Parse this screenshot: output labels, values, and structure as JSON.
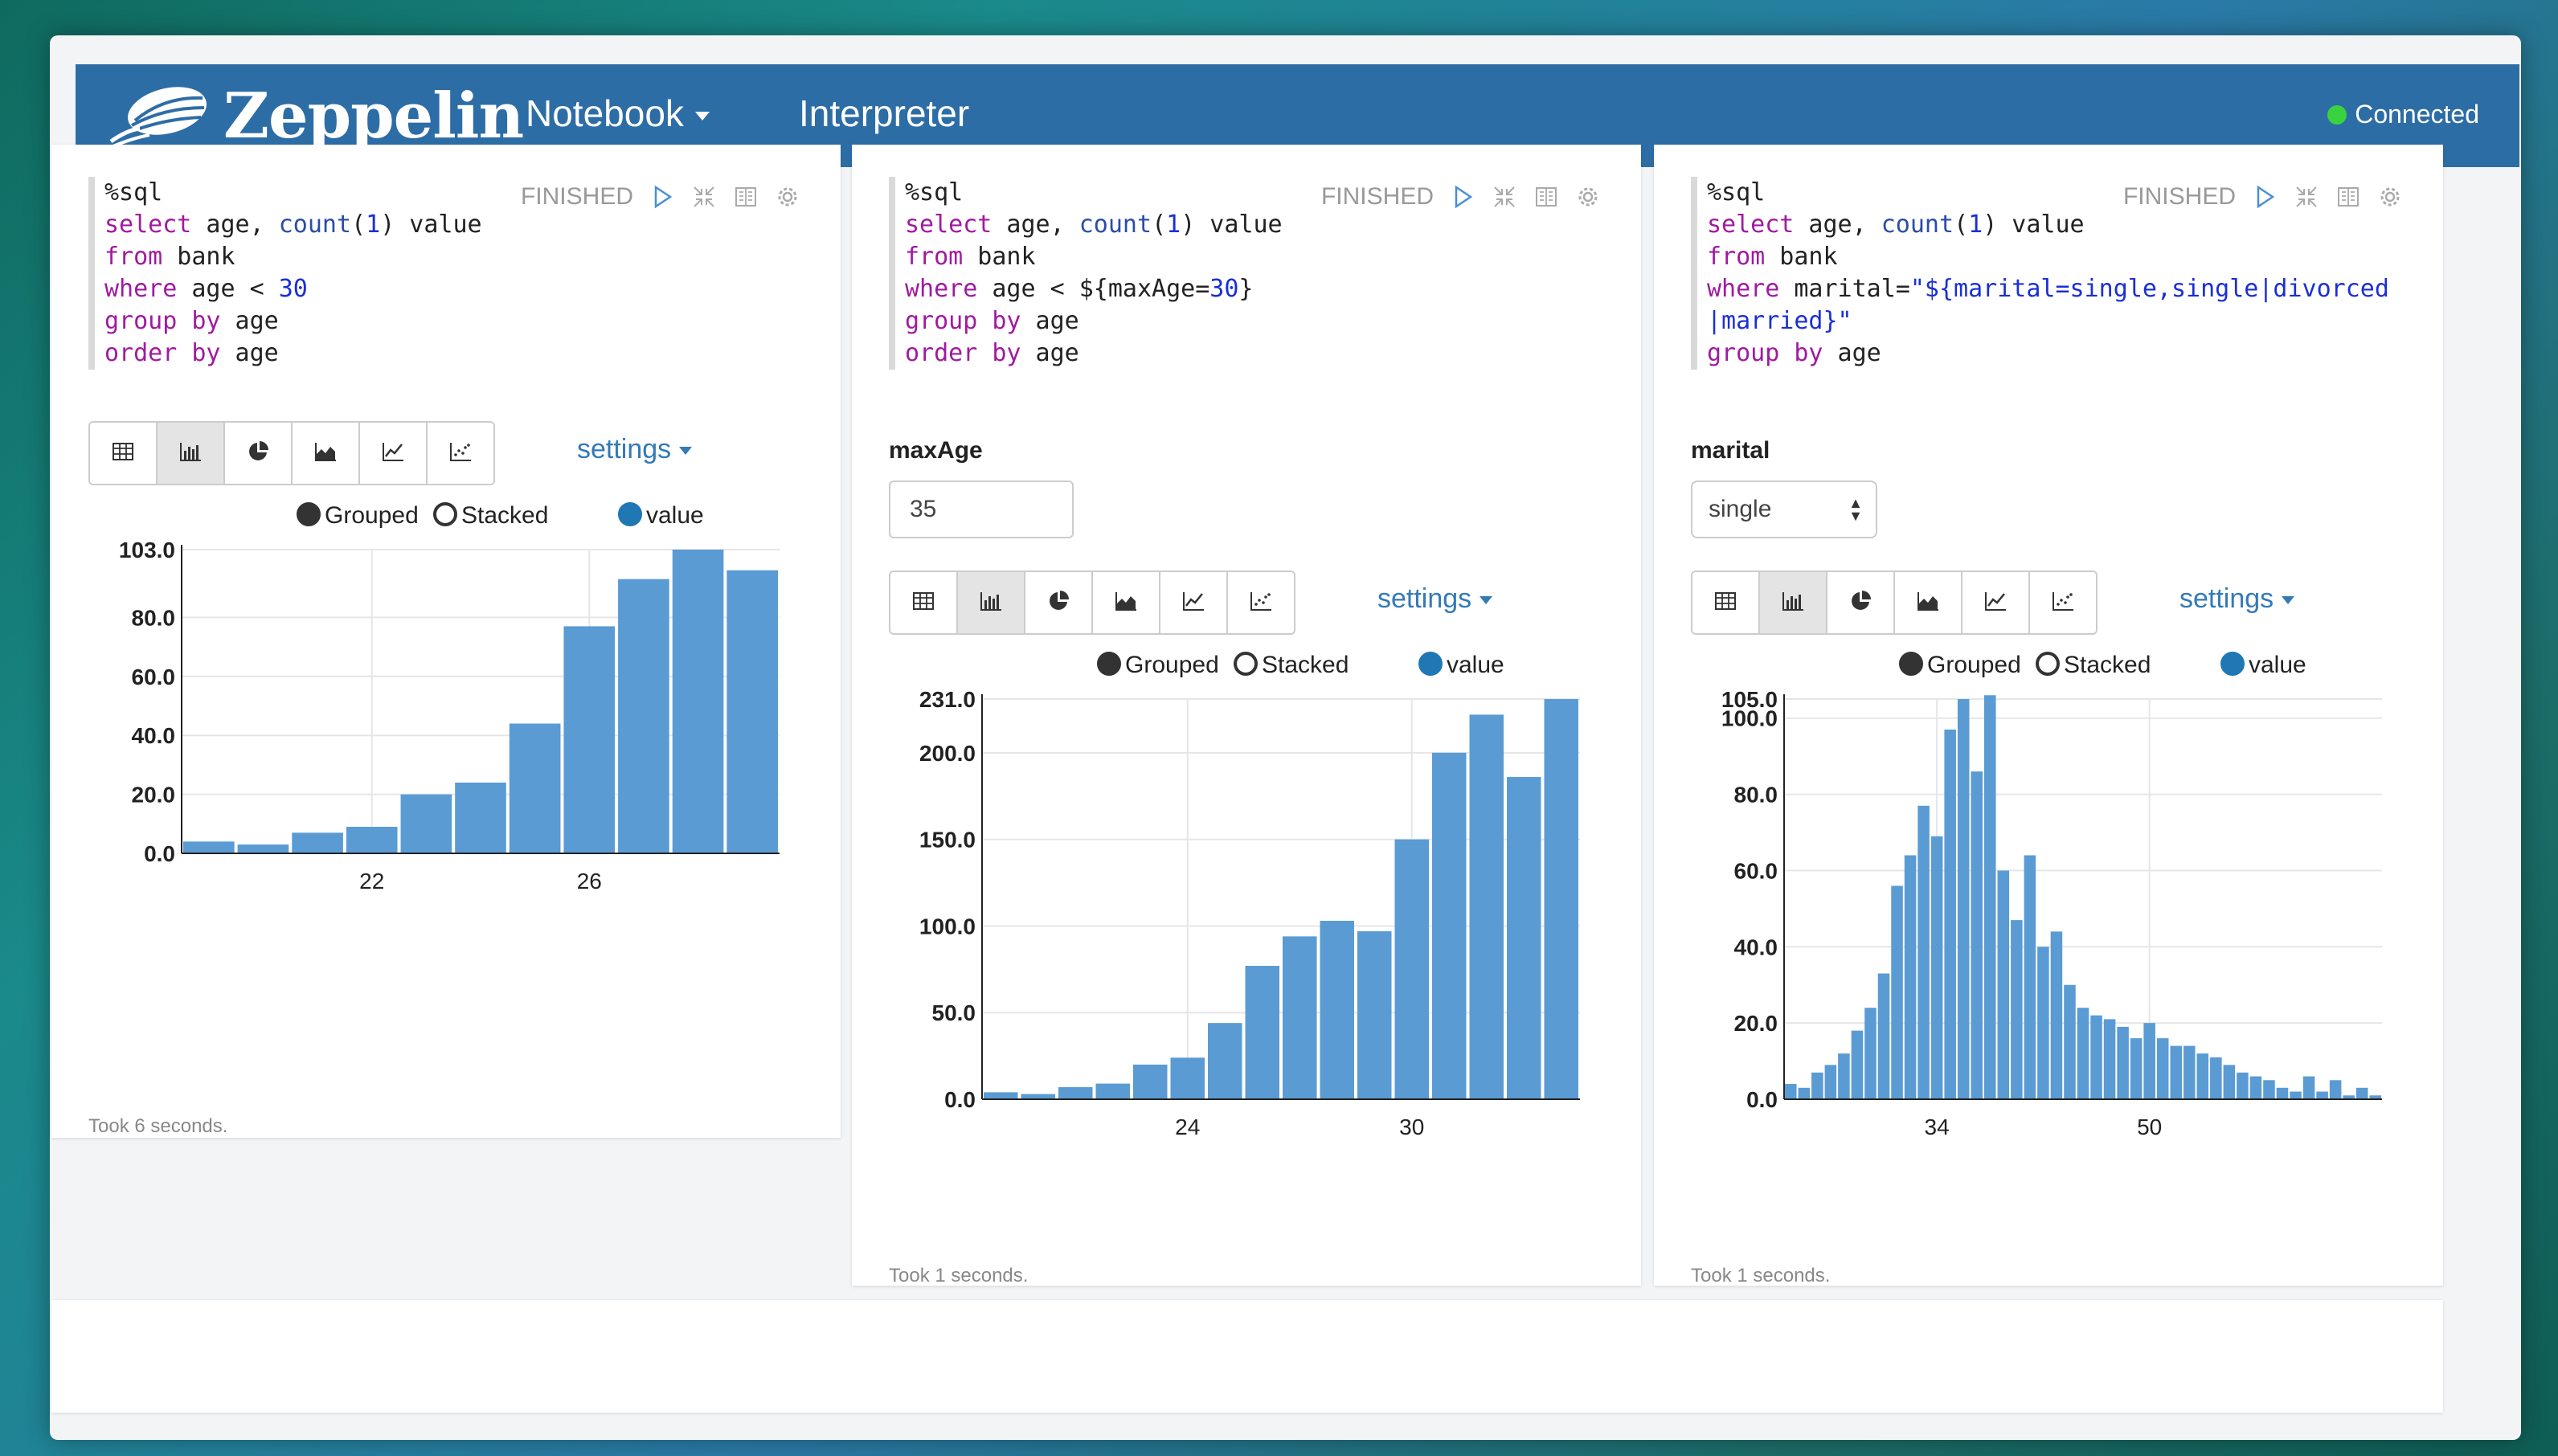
{
  "app": {
    "brand": "Zeppelin",
    "nav": {
      "notebook": "Notebook",
      "interpreter": "Interpreter"
    },
    "status": "Connected",
    "colors": {
      "navbar": "#2d6da6",
      "bar": "#5a9bd4",
      "connected": "#3ad340",
      "link": "#337ab7"
    }
  },
  "legend": {
    "grouped": "Grouped",
    "stacked": "Stacked",
    "value": "value"
  },
  "toolbar_icons": [
    "table-icon",
    "bar-chart-icon",
    "pie-chart-icon",
    "area-chart-icon",
    "line-chart-icon",
    "scatter-chart-icon"
  ],
  "paragraphs": [
    {
      "status": "FINISHED",
      "code": [
        [
          [
            "%sql",
            "plain"
          ]
        ],
        [
          [
            "select",
            "kw"
          ],
          [
            " age, ",
            "plain"
          ],
          [
            "count",
            "fn"
          ],
          [
            "(",
            "plain"
          ],
          [
            "1",
            "num"
          ],
          [
            ") value",
            "plain"
          ]
        ],
        [
          [
            "from",
            "kw"
          ],
          [
            " bank",
            "plain"
          ]
        ],
        [
          [
            "where",
            "kw"
          ],
          [
            " age < ",
            "plain"
          ],
          [
            "30",
            "num"
          ]
        ],
        [
          [
            "group by",
            "kw"
          ],
          [
            " age",
            "plain"
          ]
        ],
        [
          [
            "order by",
            "kw"
          ],
          [
            " age",
            "plain"
          ]
        ]
      ],
      "settings": "settings",
      "took": "Took 6 seconds."
    },
    {
      "status": "FINISHED",
      "code": [
        [
          [
            "%sql",
            "plain"
          ]
        ],
        [
          [
            "select",
            "kw"
          ],
          [
            " age, ",
            "plain"
          ],
          [
            "count",
            "fn"
          ],
          [
            "(",
            "plain"
          ],
          [
            "1",
            "num"
          ],
          [
            ") value",
            "plain"
          ]
        ],
        [
          [
            "from",
            "kw"
          ],
          [
            " bank",
            "plain"
          ]
        ],
        [
          [
            "where",
            "kw"
          ],
          [
            " age < ${maxAge=",
            "plain"
          ],
          [
            "30",
            "num"
          ],
          [
            "}",
            "plain"
          ]
        ],
        [
          [
            "group by",
            "kw"
          ],
          [
            " age",
            "plain"
          ]
        ],
        [
          [
            "order by",
            "kw"
          ],
          [
            " age",
            "plain"
          ]
        ]
      ],
      "param_label": "maxAge",
      "param_value": "35",
      "settings": "settings",
      "took": "Took 1 seconds."
    },
    {
      "status": "FINISHED",
      "code": [
        [
          [
            "%sql",
            "plain"
          ]
        ],
        [
          [
            "select",
            "kw"
          ],
          [
            " age, ",
            "plain"
          ],
          [
            "count",
            "fn"
          ],
          [
            "(",
            "plain"
          ],
          [
            "1",
            "num"
          ],
          [
            ") value",
            "plain"
          ]
        ],
        [
          [
            "from",
            "kw"
          ],
          [
            " bank",
            "plain"
          ]
        ],
        [
          [
            "where",
            "kw"
          ],
          [
            " marital=",
            "plain"
          ],
          [
            "\"${marital=single,single|divorced",
            "str"
          ]
        ],
        [
          [
            "|married}\"",
            "str"
          ]
        ],
        [
          [
            "group by",
            "kw"
          ],
          [
            " age",
            "plain"
          ]
        ]
      ],
      "param_label": "marital",
      "param_value": "single",
      "settings": "settings",
      "took": "Took 1 seconds."
    }
  ],
  "chart_data": [
    {
      "type": "bar",
      "x": [
        19,
        20,
        21,
        22,
        23,
        24,
        25,
        26,
        27,
        28,
        29
      ],
      "values": [
        4,
        3,
        7,
        9,
        20,
        24,
        44,
        77,
        93,
        103,
        96
      ],
      "ylim": [
        0,
        103
      ],
      "yticks": [
        0,
        20,
        40,
        60,
        80,
        103
      ],
      "ytick_labels": [
        "0.0",
        "20.0",
        "40.0",
        "60.0",
        "80.0",
        "103.0"
      ],
      "xticks": [
        22,
        26
      ],
      "xtick_labels": [
        "22",
        "26"
      ]
    },
    {
      "type": "bar",
      "x": [
        19,
        20,
        21,
        22,
        23,
        24,
        25,
        26,
        27,
        28,
        29,
        30,
        31,
        32,
        33,
        34
      ],
      "values": [
        4,
        3,
        7,
        9,
        20,
        24,
        44,
        77,
        94,
        103,
        97,
        150,
        200,
        222,
        186,
        231
      ],
      "ylim": [
        0,
        231
      ],
      "yticks": [
        0,
        50,
        100,
        150,
        200,
        231
      ],
      "ytick_labels": [
        "0.0",
        "50.0",
        "100.0",
        "150.0",
        "200.0",
        "231.0"
      ],
      "xticks": [
        24,
        30
      ],
      "xtick_labels": [
        "24",
        "30"
      ]
    },
    {
      "type": "bar",
      "x": [
        23,
        24,
        25,
        26,
        27,
        28,
        29,
        30,
        31,
        32,
        33,
        34,
        35,
        36,
        37,
        38,
        39,
        40,
        41,
        42,
        43,
        44,
        45,
        46,
        47,
        48,
        49,
        50,
        51,
        52,
        53,
        54,
        55,
        56,
        57,
        58,
        59,
        60,
        61,
        62,
        63,
        64,
        65,
        66,
        67
      ],
      "values": [
        4,
        3,
        7,
        9,
        12,
        18,
        24,
        33,
        56,
        64,
        77,
        69,
        97,
        105,
        86,
        106,
        60,
        47,
        64,
        40,
        44,
        30,
        24,
        22,
        21,
        19,
        16,
        20,
        16,
        14,
        14,
        12,
        11,
        9,
        7,
        6,
        5,
        3,
        2,
        6,
        2,
        5,
        1,
        3,
        1
      ],
      "ylim": [
        0,
        105
      ],
      "yticks": [
        0,
        20,
        40,
        60,
        80,
        100,
        105
      ],
      "ytick_labels": [
        "0.0",
        "20.0",
        "40.0",
        "60.0",
        "80.0",
        "100.0",
        "105.0"
      ],
      "xticks": [
        34,
        50
      ],
      "xtick_labels": [
        "34",
        "50"
      ]
    }
  ]
}
